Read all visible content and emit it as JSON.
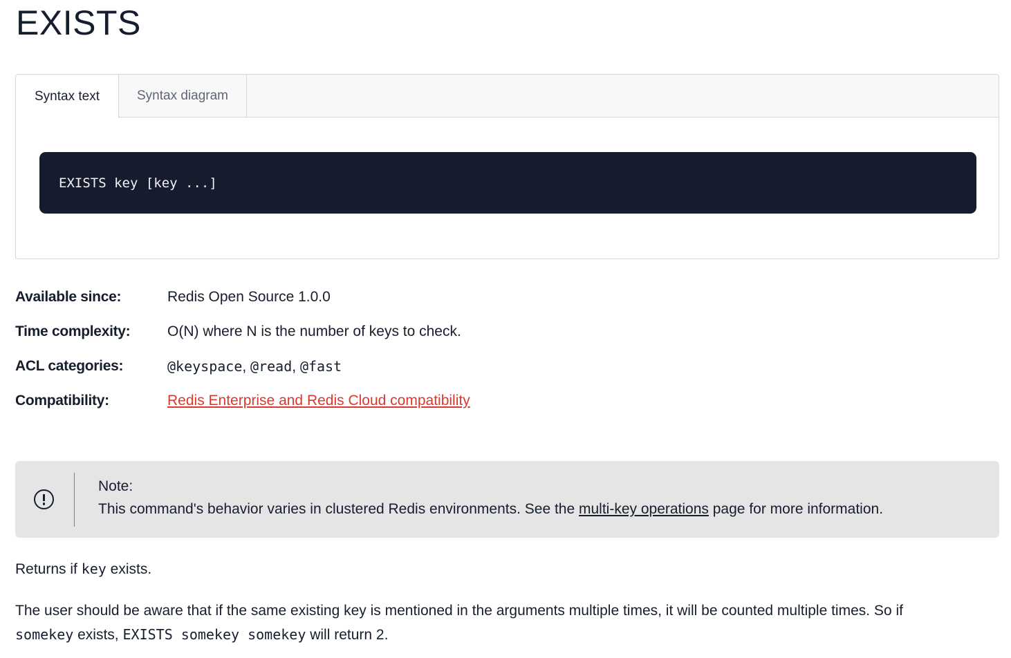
{
  "page": {
    "title": "EXISTS"
  },
  "syntax": {
    "tabs": [
      {
        "label": "Syntax text",
        "active": true
      },
      {
        "label": "Syntax diagram",
        "active": false
      }
    ],
    "code": "EXISTS key [key ...]"
  },
  "meta": {
    "available_since": {
      "label": "Available since:",
      "value": "Redis Open Source 1.0.0"
    },
    "time_complexity": {
      "label": "Time complexity:",
      "value": "O(N) where N is the number of keys to check."
    },
    "acl_categories": {
      "label": "ACL categories:",
      "values": [
        "@keyspace",
        "@read",
        "@fast"
      ],
      "separator": ", "
    },
    "compatibility": {
      "label": "Compatibility:",
      "link": "Redis Enterprise and Redis Cloud compatibility"
    }
  },
  "note": {
    "icon": "exclamation-circle-icon",
    "title": "Note:",
    "text_before": "This command's behavior varies in clustered Redis environments. See the ",
    "link": "multi-key operations",
    "text_after": " page for more information."
  },
  "body": {
    "p1_before": "Returns if ",
    "p1_code": "key",
    "p1_after": " exists.",
    "p2_line1": "The user should be aware that if the same existing key is mentioned in the arguments multiple times, it will be counted multiple times. So if",
    "p2_code1": "somekey",
    "p2_mid1": " exists, ",
    "p2_code2": "EXISTS somekey somekey",
    "p2_after": " will return 2."
  },
  "colors": {
    "code_bg": "#161b2e",
    "link_red": "#dc382d",
    "note_bg": "#e5e5e5",
    "text": "#161e2e"
  }
}
